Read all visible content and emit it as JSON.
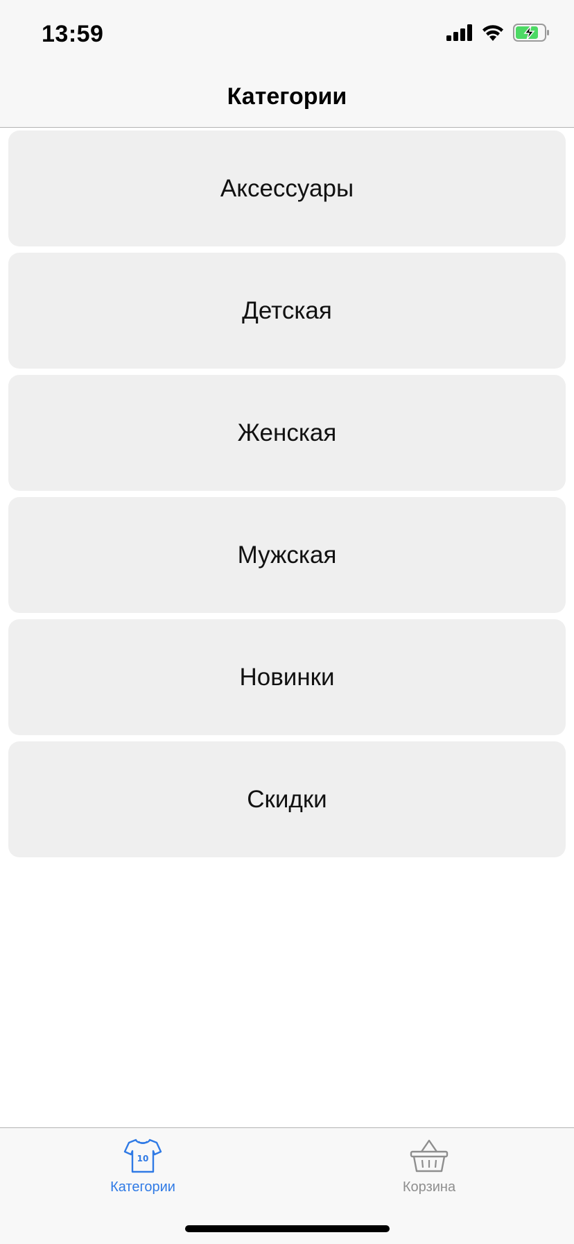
{
  "status_bar": {
    "time": "13:59",
    "icons": [
      "cellular-signal-icon",
      "wifi-icon",
      "battery-charging-icon"
    ]
  },
  "nav": {
    "title": "Категории"
  },
  "categories": [
    {
      "label": "Аксессуары"
    },
    {
      "label": "Детская"
    },
    {
      "label": "Женская"
    },
    {
      "label": "Мужская"
    },
    {
      "label": "Новинки"
    },
    {
      "label": "Скидки"
    }
  ],
  "tab_bar": {
    "tabs": [
      {
        "label": "Категории",
        "icon": "tshirt-icon",
        "active": true
      },
      {
        "label": "Корзина",
        "icon": "basket-icon",
        "active": false
      }
    ]
  },
  "colors": {
    "accent": "#2f7ae5",
    "inactive": "#8e8e8e",
    "card": "#efefef",
    "battery_charge": "#4cd964"
  }
}
